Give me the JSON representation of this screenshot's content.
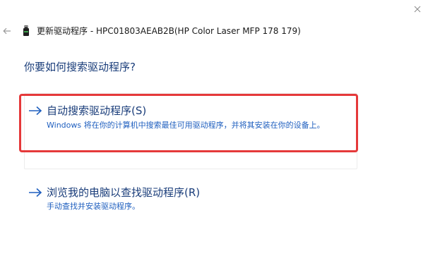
{
  "window": {
    "title": "更新驱动程序 - HPC01803AEAB2B(HP Color Laser MFP 178 179)",
    "close_icon": "close-icon",
    "back_icon": "back-arrow-icon",
    "device_icon": "usb-device-icon"
  },
  "main": {
    "question": "你要如何搜索驱动程序?",
    "options": [
      {
        "title": "自动搜索驱动程序(S)",
        "description": "Windows 将在你的计算机中搜索最佳可用驱动程序，并将其安装在你的设备上。",
        "icon": "arrow-right-icon"
      },
      {
        "title": "浏览我的电脑以查找驱动程序(R)",
        "description": "手动查找并安装驱动程序。",
        "icon": "arrow-right-icon"
      }
    ]
  },
  "colors": {
    "accent_text": "#1a3d7a",
    "link_desc": "#1f5fbf",
    "highlight": "#e5393a"
  }
}
